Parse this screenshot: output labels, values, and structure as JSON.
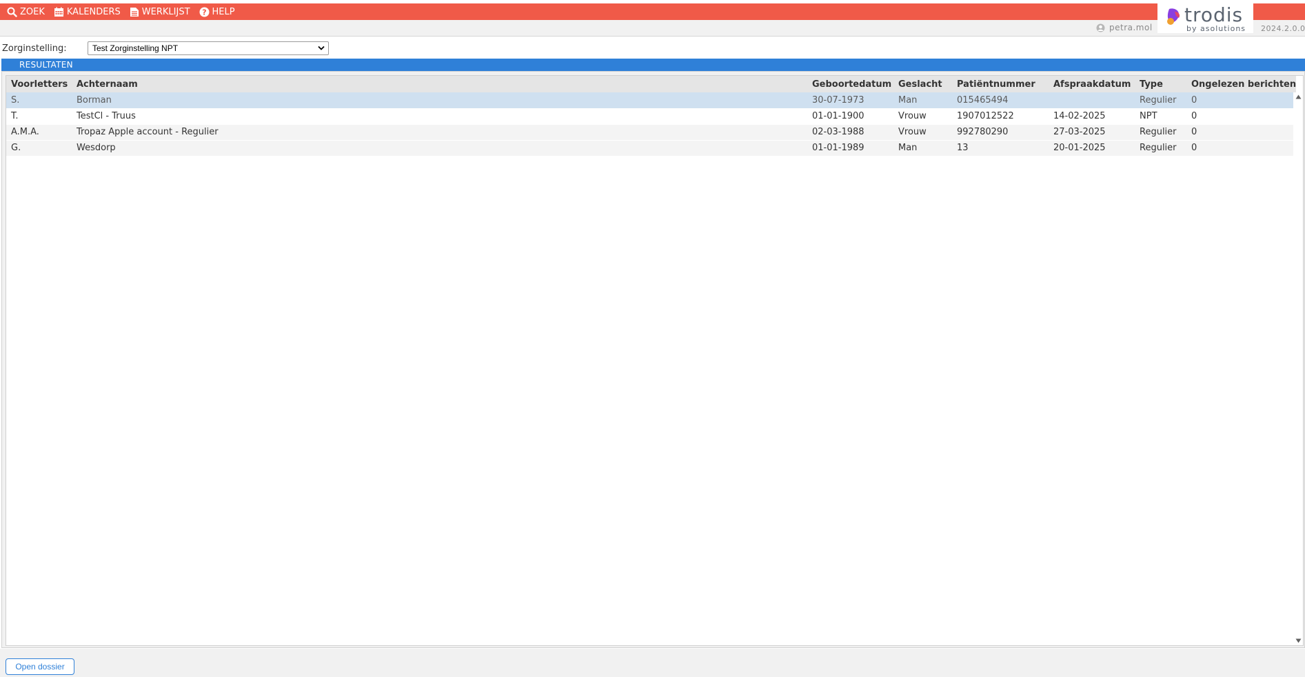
{
  "nav": {
    "items": [
      {
        "label": "ZOEK",
        "icon": "search-icon"
      },
      {
        "label": "KALENDERS",
        "icon": "calendar-icon"
      },
      {
        "label": "WERKLIJST",
        "icon": "document-icon"
      },
      {
        "label": "HELP",
        "icon": "help-icon"
      }
    ]
  },
  "brand": {
    "name": "trodis",
    "sub": "by asolutions",
    "version": "2024.2.0.0"
  },
  "user": {
    "name": "petra.mol"
  },
  "filter": {
    "label": "Zorginstelling:",
    "selected": "Test Zorginstelling NPT"
  },
  "results": {
    "title": "RESULTATEN",
    "columns": [
      "Voorletters",
      "Achternaam",
      "Geboortedatum",
      "Geslacht",
      "Patiëntnummer",
      "Afspraakdatum",
      "Type",
      "Ongelezen berichten"
    ],
    "rows": [
      [
        "S.",
        "Borman",
        "30-07-1973",
        "Man",
        "015465494",
        "",
        "Regulier",
        "0"
      ],
      [
        "T.",
        "TestCl - Truus",
        "01-01-1900",
        "Vrouw",
        "1907012522",
        "14-02-2025",
        "NPT",
        "0"
      ],
      [
        "A.M.A.",
        "Tropaz Apple account - Regulier",
        "02-03-1988",
        "Vrouw",
        "992780290",
        "27-03-2025",
        "Regulier",
        "0"
      ],
      [
        "G.",
        "Wesdorp",
        "01-01-1989",
        "Man",
        "13",
        "20-01-2025",
        "Regulier",
        "0"
      ]
    ]
  },
  "footer": {
    "open_label": "Open dossier"
  },
  "colors": {
    "nav_red": "#f05a48",
    "accent_blue": "#2f80d8",
    "selected_row": "#cfe0f0"
  }
}
